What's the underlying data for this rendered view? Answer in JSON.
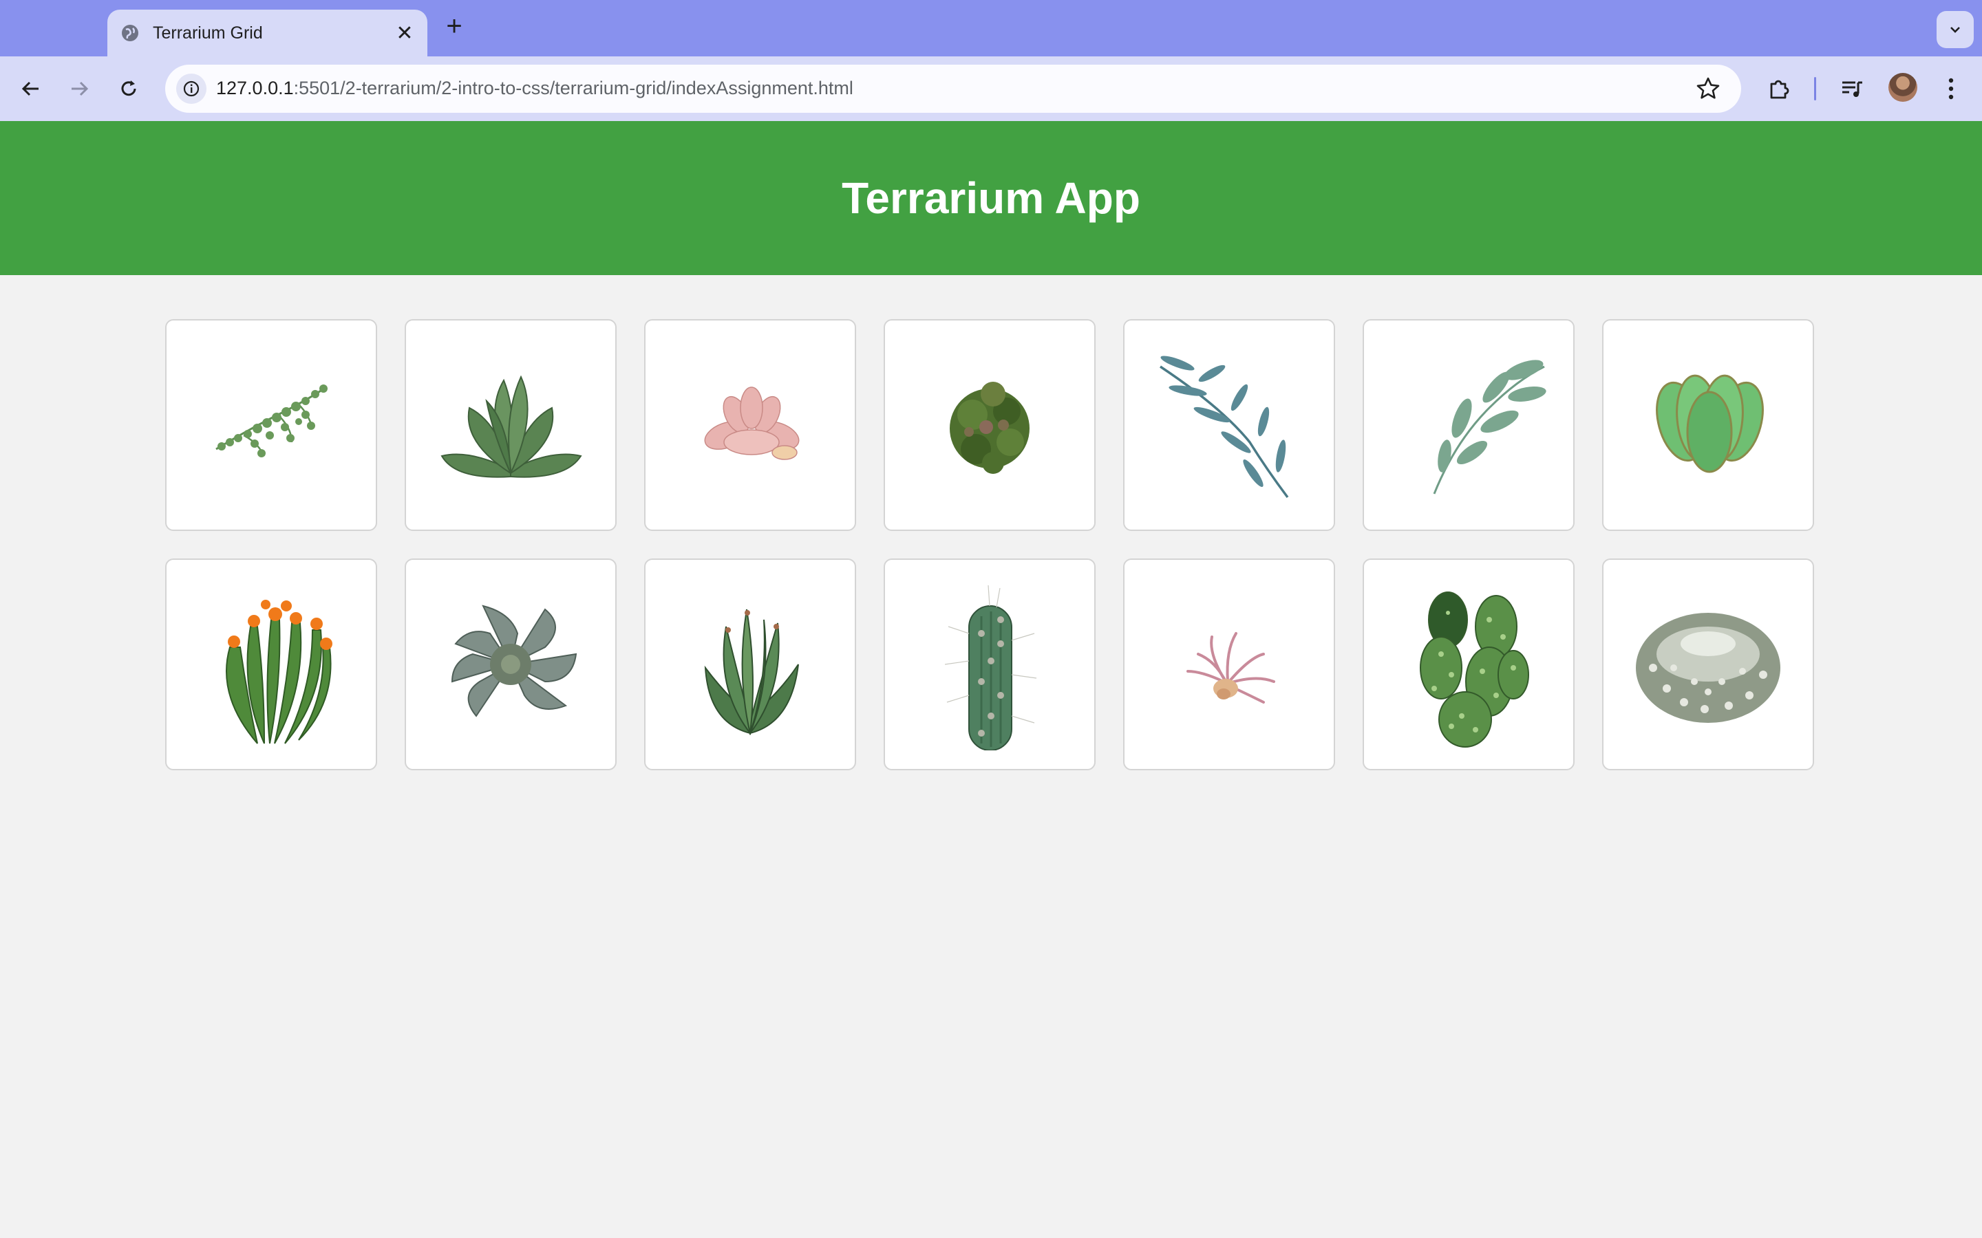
{
  "browser": {
    "tab": {
      "title": "Terrarium Grid",
      "favicon": "globe-icon",
      "close": "close-icon"
    },
    "new_tab": "plus-icon",
    "address": {
      "host": "127.0.0.1",
      "path": ":5501/2-terrarium/2-intro-to-css/terrarium-grid/indexAssignment.html"
    },
    "colors": {
      "tabstrip": "#8891ee",
      "toolbar": "#d7daf8"
    }
  },
  "page": {
    "title": "Terrarium App",
    "header_color": "#42a142",
    "plants": [
      {
        "name": "string-of-pearls"
      },
      {
        "name": "green-succulent-rosette"
      },
      {
        "name": "pink-succulent"
      },
      {
        "name": "dark-green-shrub"
      },
      {
        "name": "blue-green-eucalyptus-branch"
      },
      {
        "name": "sage-green-branch"
      },
      {
        "name": "jade-succulent"
      },
      {
        "name": "orange-flowering-cactus"
      },
      {
        "name": "grey-echeveria"
      },
      {
        "name": "aloe-plant"
      },
      {
        "name": "columnar-cactus"
      },
      {
        "name": "air-plant"
      },
      {
        "name": "prickly-pear-cactus"
      },
      {
        "name": "round-white-cactus"
      }
    ]
  }
}
